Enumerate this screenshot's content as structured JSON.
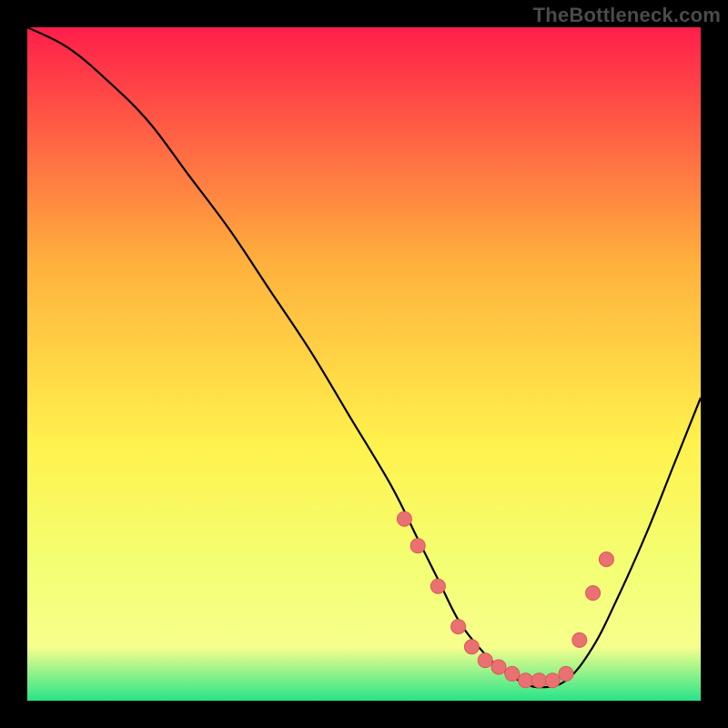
{
  "watermark": "TheBottleneck.com",
  "colors": {
    "background": "#000000",
    "gradient_top": "#ff1e4a",
    "gradient_mid1": "#ffb13d",
    "gradient_mid2": "#fff24d",
    "gradient_mid3": "#f3ff73",
    "gradient_bottom_yellow": "#f7ff8c",
    "gradient_bottom_green": "#27e489",
    "curve": "#000000",
    "marker_fill": "#e97171",
    "marker_stroke": "#d85a5a"
  },
  "chart_data": {
    "type": "line",
    "title": "",
    "xlabel": "",
    "ylabel": "",
    "xlim": [
      0,
      100
    ],
    "ylim": [
      0,
      100
    ],
    "series": [
      {
        "name": "bottleneck-curve",
        "x": [
          0,
          6,
          12,
          18,
          24,
          30,
          36,
          42,
          48,
          54,
          58,
          61,
          64,
          67,
          70,
          73,
          76,
          80,
          84,
          88,
          92,
          96,
          100
        ],
        "y": [
          100,
          97,
          92,
          86,
          78,
          70,
          61,
          52,
          42,
          32,
          24,
          18,
          12,
          8,
          5,
          3,
          2,
          3,
          8,
          16,
          25,
          35,
          45
        ]
      }
    ],
    "markers": {
      "name": "highlight-points",
      "x": [
        56,
        58,
        61,
        64,
        66,
        68,
        70,
        72,
        74,
        76,
        78,
        80,
        82,
        84,
        86
      ],
      "y": [
        27,
        23,
        17,
        11,
        8,
        6,
        5,
        4,
        3,
        3,
        3,
        4,
        9,
        16,
        21
      ]
    }
  }
}
